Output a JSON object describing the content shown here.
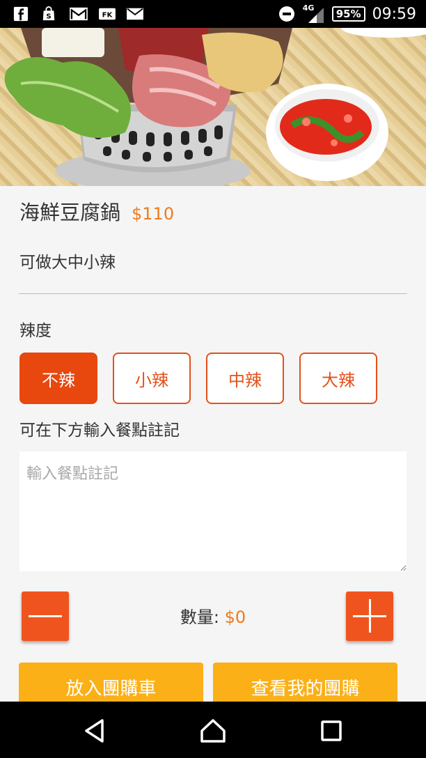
{
  "status_bar": {
    "battery": "95%",
    "time": "09:59",
    "network": "4G",
    "notification_icons": [
      "facebook-icon",
      "shopping-bag-icon",
      "gmail-icon",
      "fk-icon",
      "mail-icon"
    ]
  },
  "dish": {
    "name": "海鮮豆腐鍋",
    "price": "$110",
    "description": "可做大中小辣"
  },
  "spice": {
    "label": "辣度",
    "options": [
      "不辣",
      "小辣",
      "中辣",
      "大辣"
    ],
    "selected": "不辣"
  },
  "note": {
    "label": "可在下方輸入餐點註記",
    "placeholder": "輸入餐點註記",
    "value": ""
  },
  "quantity": {
    "label": "數量: ",
    "value": "$0"
  },
  "actions": {
    "add_to_cart": "放入團購車",
    "view_group_buy": "查看我的團購"
  },
  "colors": {
    "accent": "#e8470e",
    "price": "#f07a1a",
    "action": "#fbb017"
  }
}
